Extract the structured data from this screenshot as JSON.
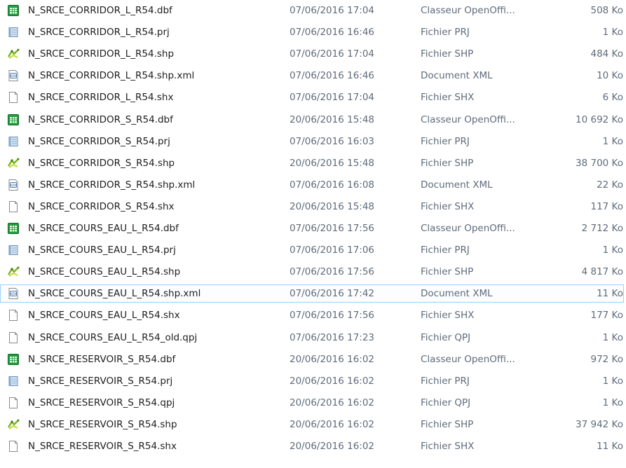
{
  "files": [
    {
      "name": "N_SRCE_CORRIDOR_L_R54.dbf",
      "date": "07/06/2016 17:04",
      "type": "Classeur OpenOffi...",
      "size": "508 Ko",
      "icon": "spreadsheet-icon"
    },
    {
      "name": "N_SRCE_CORRIDOR_L_R54.prj",
      "date": "07/06/2016 16:46",
      "type": "Fichier PRJ",
      "size": "1 Ko",
      "icon": "prj-file-icon"
    },
    {
      "name": "N_SRCE_CORRIDOR_L_R54.shp",
      "date": "07/06/2016 17:04",
      "type": "Fichier SHP",
      "size": "484 Ko",
      "icon": "shapefile-icon"
    },
    {
      "name": "N_SRCE_CORRIDOR_L_R54.shp.xml",
      "date": "07/06/2016 16:46",
      "type": "Document XML",
      "size": "10 Ko",
      "icon": "xml-file-icon"
    },
    {
      "name": "N_SRCE_CORRIDOR_L_R54.shx",
      "date": "07/06/2016 17:04",
      "type": "Fichier SHX",
      "size": "6 Ko",
      "icon": "blank-file-icon"
    },
    {
      "name": "N_SRCE_CORRIDOR_S_R54.dbf",
      "date": "20/06/2016 15:48",
      "type": "Classeur OpenOffi...",
      "size": "10 692 Ko",
      "icon": "spreadsheet-icon"
    },
    {
      "name": "N_SRCE_CORRIDOR_S_R54.prj",
      "date": "07/06/2016 16:03",
      "type": "Fichier PRJ",
      "size": "1 Ko",
      "icon": "prj-file-icon"
    },
    {
      "name": "N_SRCE_CORRIDOR_S_R54.shp",
      "date": "20/06/2016 15:48",
      "type": "Fichier SHP",
      "size": "38 700 Ko",
      "icon": "shapefile-icon"
    },
    {
      "name": "N_SRCE_CORRIDOR_S_R54.shp.xml",
      "date": "07/06/2016 16:08",
      "type": "Document XML",
      "size": "22 Ko",
      "icon": "xml-file-icon"
    },
    {
      "name": "N_SRCE_CORRIDOR_S_R54.shx",
      "date": "20/06/2016 15:48",
      "type": "Fichier SHX",
      "size": "117 Ko",
      "icon": "blank-file-icon"
    },
    {
      "name": "N_SRCE_COURS_EAU_L_R54.dbf",
      "date": "07/06/2016 17:56",
      "type": "Classeur OpenOffi...",
      "size": "2 712 Ko",
      "icon": "spreadsheet-icon"
    },
    {
      "name": "N_SRCE_COURS_EAU_L_R54.prj",
      "date": "07/06/2016 17:06",
      "type": "Fichier PRJ",
      "size": "1 Ko",
      "icon": "prj-file-icon"
    },
    {
      "name": "N_SRCE_COURS_EAU_L_R54.shp",
      "date": "07/06/2016 17:56",
      "type": "Fichier SHP",
      "size": "4 817 Ko",
      "icon": "shapefile-icon"
    },
    {
      "name": "N_SRCE_COURS_EAU_L_R54.shp.xml",
      "date": "07/06/2016 17:42",
      "type": "Document XML",
      "size": "11 Ko",
      "icon": "xml-file-icon",
      "selected": true
    },
    {
      "name": "N_SRCE_COURS_EAU_L_R54.shx",
      "date": "07/06/2016 17:56",
      "type": "Fichier SHX",
      "size": "177 Ko",
      "icon": "blank-file-icon"
    },
    {
      "name": "N_SRCE_COURS_EAU_L_R54_old.qpj",
      "date": "07/06/2016 17:23",
      "type": "Fichier QPJ",
      "size": "1 Ko",
      "icon": "blank-file-icon"
    },
    {
      "name": "N_SRCE_RESERVOIR_S_R54.dbf",
      "date": "20/06/2016 16:02",
      "type": "Classeur OpenOffi...",
      "size": "972 Ko",
      "icon": "spreadsheet-icon"
    },
    {
      "name": "N_SRCE_RESERVOIR_S_R54.prj",
      "date": "20/06/2016 16:02",
      "type": "Fichier PRJ",
      "size": "1 Ko",
      "icon": "prj-file-icon"
    },
    {
      "name": "N_SRCE_RESERVOIR_S_R54.qpj",
      "date": "20/06/2016 16:02",
      "type": "Fichier QPJ",
      "size": "1 Ko",
      "icon": "blank-file-icon"
    },
    {
      "name": "N_SRCE_RESERVOIR_S_R54.shp",
      "date": "20/06/2016 16:02",
      "type": "Fichier SHP",
      "size": "37 942 Ko",
      "icon": "shapefile-icon"
    },
    {
      "name": "N_SRCE_RESERVOIR_S_R54.shx",
      "date": "20/06/2016 16:02",
      "type": "Fichier SHX",
      "size": "11 Ko",
      "icon": "blank-file-icon"
    }
  ],
  "colors": {
    "selection_border": "#99d1ff",
    "secondary_text": "#5f6b7a",
    "spreadsheet_green": "#1e9e3a",
    "shapefile_green": "#7ab51d"
  }
}
